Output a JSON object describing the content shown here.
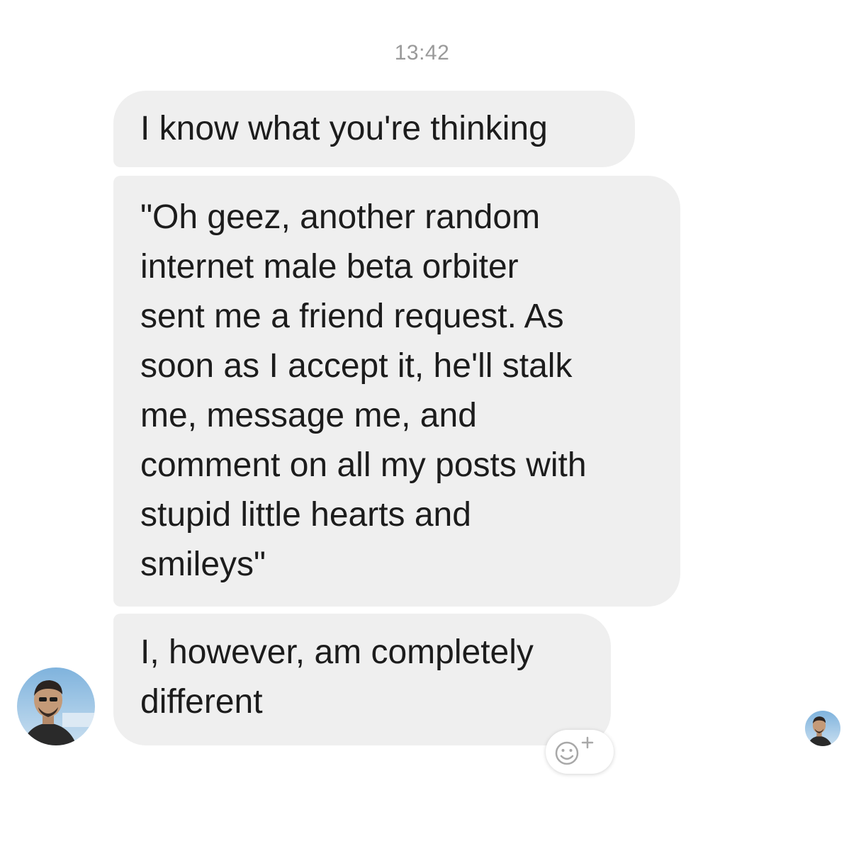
{
  "conversation": {
    "timestamp": "13:42",
    "messages": [
      {
        "text": "I know what you're thinking"
      },
      {
        "text": "\"Oh geez, another random\ninternet male beta orbiter\nsent me a friend request. As\nsoon as I accept it, he'll stalk\nme, message me, and\ncomment on all my posts with\nstupid little hearts and\nsmileys\""
      },
      {
        "text": "I, however, am completely\ndifferent"
      }
    ]
  },
  "sender": {
    "avatar_icon": "profile-photo"
  },
  "read_receipt": {
    "avatar_icon": "profile-photo-small"
  },
  "reaction": {
    "icon": "smiley-add-icon"
  },
  "colors": {
    "bubble_background": "#efefef",
    "message_text": "#1c1c1c",
    "timestamp_text": "#9a9a9a",
    "page_background": "#ffffff"
  }
}
